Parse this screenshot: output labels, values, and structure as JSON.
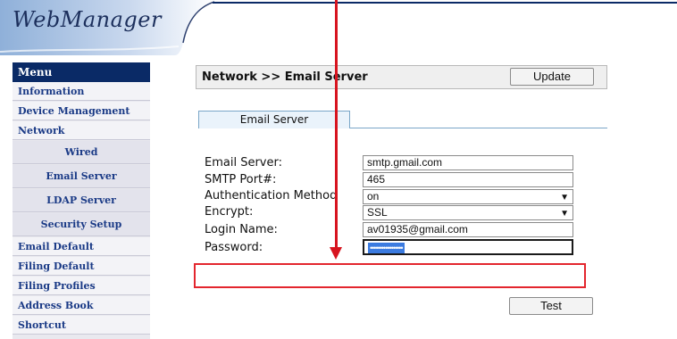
{
  "header": {
    "logo_text": "WebManager"
  },
  "sidebar": {
    "menu_title": "Menu",
    "items": [
      {
        "label": "Information"
      },
      {
        "label": "Device Management"
      },
      {
        "label": "Network"
      },
      {
        "label": "Wired"
      },
      {
        "label": "Email Server"
      },
      {
        "label": "LDAP Server"
      },
      {
        "label": "Security Setup"
      },
      {
        "label": "Email Default"
      },
      {
        "label": "Filing Default"
      },
      {
        "label": "Filing Profiles"
      },
      {
        "label": "Address Book"
      },
      {
        "label": "Shortcut"
      }
    ]
  },
  "main": {
    "breadcrumb": "Network >> Email Server",
    "update_label": "Update",
    "tab_label": "Email Server",
    "form": {
      "email_server_label": "Email Server:",
      "email_server_value": "smtp.gmail.com",
      "smtp_port_label": "SMTP Port#:",
      "smtp_port_value": "465",
      "auth_label": "Authentication Method",
      "auth_value": "on",
      "encrypt_label": "Encrypt:",
      "encrypt_value": "SSL",
      "login_label": "Login Name:",
      "login_value": "av01935@gmail.com",
      "password_label": "Password:",
      "password_value": "•••••••••••••••••"
    },
    "test_label": "Test"
  },
  "colors": {
    "menu_header": "#0a2a66",
    "menu_text": "#1a3a86",
    "annotation_red": "#e3262e",
    "selection_blue": "#3b7be0"
  }
}
